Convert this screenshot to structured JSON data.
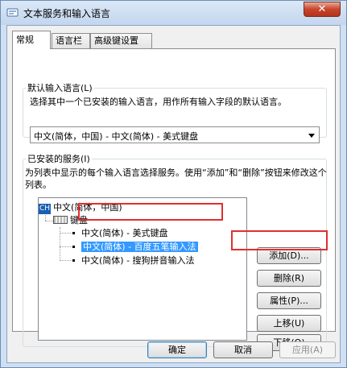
{
  "window": {
    "title": "文本服务和输入语言",
    "close_label": "✕"
  },
  "tabs": [
    "常规",
    "语言栏",
    "高级键设置"
  ],
  "default_language": {
    "legend": "默认输入语言(L)",
    "description": "选择其中一个已安装的输入语言，用作所有输入字段的默认语言。",
    "selected": "中文(简体，中国) - 中文(简体) - 美式键盘"
  },
  "installed_services": {
    "legend": "已安装的服务(I)",
    "description": "为列表中显示的每个输入语言选择服务。使用“添加”和“删除”按钮来修改这个列表。",
    "tree": {
      "language_badge": "CH",
      "language": "中文(简体，中国)",
      "category": "键盘",
      "items": [
        {
          "label": "中文(简体) - 美式键盘",
          "selected": false
        },
        {
          "label": "中文(简体) - 百度五笔输入法",
          "selected": true
        },
        {
          "label": "中文(简体) - 搜狗拼音输入法",
          "selected": false
        }
      ]
    },
    "buttons": {
      "add": "添加(D)...",
      "remove": "删除(R)",
      "properties": "属性(P)...",
      "move_up": "上移(U)",
      "move_down": "下移(O)"
    }
  },
  "footer": {
    "ok": "确定",
    "cancel": "取消",
    "apply": "应用(A)"
  },
  "colors": {
    "highlight": "#e03030",
    "selection": "#3399ff"
  }
}
